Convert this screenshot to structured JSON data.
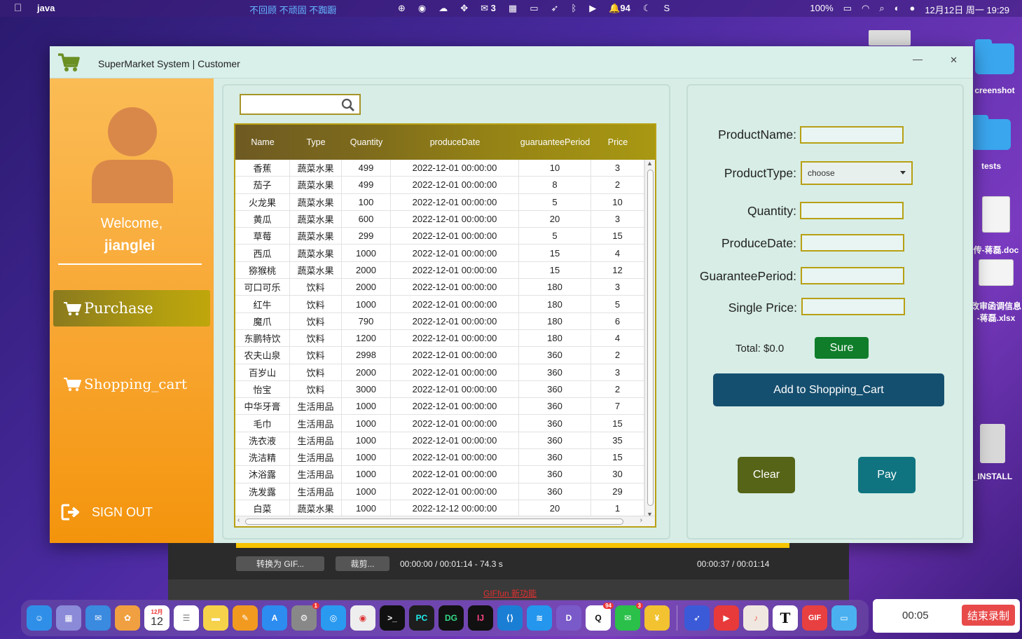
{
  "menubar": {
    "app_name": "java",
    "center_text": "不回顾 不顽固 不踟蹰",
    "wechat_count": "3",
    "notif_count": "94",
    "battery": "100%",
    "datetime": "12月12日 周一  19:29"
  },
  "desktop": {
    "screenshot_label": "creenshot",
    "tests_label": "tests",
    "doc_label": "传-蒋磊.doc",
    "xlsx_label_1": "改审函调信息",
    "xlsx_label_2": "-蒋磊.xlsx",
    "install_label": "_INSTALL"
  },
  "window": {
    "title": "SuperMarket System | Customer",
    "minimize": "—",
    "close": "✕"
  },
  "sidebar": {
    "welcome": "Welcome,",
    "username": "jianglei",
    "purchase_label": "Purchase",
    "cart_label": "Shopping_cart",
    "signout_label": "SIGN OUT"
  },
  "search": {
    "value": "",
    "placeholder": ""
  },
  "table": {
    "headers": [
      "Name",
      "Type",
      "Quantity",
      "produceDate",
      "guaruanteePeriod",
      "Price"
    ],
    "rows": [
      [
        "香蕉",
        "蔬菜水果",
        "499",
        "2022-12-01 00:00:00",
        "10",
        "3"
      ],
      [
        "茄子",
        "蔬菜水果",
        "499",
        "2022-12-01 00:00:00",
        "8",
        "2"
      ],
      [
        "火龙果",
        "蔬菜水果",
        "100",
        "2022-12-01 00:00:00",
        "5",
        "10"
      ],
      [
        "黄瓜",
        "蔬菜水果",
        "600",
        "2022-12-01 00:00:00",
        "20",
        "3"
      ],
      [
        "草莓",
        "蔬菜水果",
        "299",
        "2022-12-01 00:00:00",
        "5",
        "15"
      ],
      [
        "西瓜",
        "蔬菜水果",
        "1000",
        "2022-12-01 00:00:00",
        "15",
        "4"
      ],
      [
        "猕猴桃",
        "蔬菜水果",
        "2000",
        "2022-12-01 00:00:00",
        "15",
        "12"
      ],
      [
        "可口可乐",
        "饮料",
        "2000",
        "2022-12-01 00:00:00",
        "180",
        "3"
      ],
      [
        "红牛",
        "饮料",
        "1000",
        "2022-12-01 00:00:00",
        "180",
        "5"
      ],
      [
        "魔爪",
        "饮料",
        "790",
        "2022-12-01 00:00:00",
        "180",
        "6"
      ],
      [
        "东鹏特饮",
        "饮料",
        "1200",
        "2022-12-01 00:00:00",
        "180",
        "4"
      ],
      [
        "农夫山泉",
        "饮料",
        "2998",
        "2022-12-01 00:00:00",
        "360",
        "2"
      ],
      [
        "百岁山",
        "饮料",
        "2000",
        "2022-12-01 00:00:00",
        "360",
        "3"
      ],
      [
        "怡宝",
        "饮料",
        "3000",
        "2022-12-01 00:00:00",
        "360",
        "2"
      ],
      [
        "中华牙膏",
        "生活用品",
        "1000",
        "2022-12-01 00:00:00",
        "360",
        "7"
      ],
      [
        "毛巾",
        "生活用品",
        "1000",
        "2022-12-01 00:00:00",
        "360",
        "15"
      ],
      [
        "洗衣液",
        "生活用品",
        "1000",
        "2022-12-01 00:00:00",
        "360",
        "35"
      ],
      [
        "洗洁精",
        "生活用品",
        "1000",
        "2022-12-01 00:00:00",
        "360",
        "15"
      ],
      [
        "沐浴露",
        "生活用品",
        "1000",
        "2022-12-01 00:00:00",
        "360",
        "30"
      ],
      [
        "洗发露",
        "生活用品",
        "1000",
        "2022-12-01 00:00:00",
        "360",
        "29"
      ],
      [
        "白菜",
        "蔬菜水果",
        "1000",
        "2022-12-12 00:00:00",
        "20",
        "1"
      ]
    ]
  },
  "form": {
    "product_name_label": "ProductName:",
    "product_type_label": "ProductType:",
    "product_type_value": "choose",
    "quantity_label": "Quantity:",
    "produce_date_label": "ProduceDate:",
    "guarantee_label": "GuaranteePeriod:",
    "price_label": "Single Price:",
    "total_label": "Total: $0.0",
    "sure_label": "Sure",
    "add_label": "Add to Shopping_Cart",
    "clear_label": "Clear",
    "pay_label": "Pay"
  },
  "recorder": {
    "convert_label": "转换为 GIF...",
    "crop_label": "裁剪...",
    "time_left": "00:00:00 / 00:01:14 - 74.3 s",
    "time_right": "00:00:37 / 00:01:14",
    "link_label": "GIFfun 新功能"
  },
  "dock": {
    "calendar_month": "12月",
    "calendar_day": "12",
    "gif_label": "GIF",
    "text_label": "T"
  },
  "rec_widget": {
    "time": "00:05",
    "stop_label": "结束录制"
  },
  "colors": {
    "sidebar_orange": "#f8a632",
    "purchase_nav": "#b29e10",
    "table_header": "#7d6a1c",
    "sure_green": "#0f7d2a",
    "add_blue": "#154f6f",
    "clear_olive": "#556417",
    "pay_teal": "#0f7480",
    "panel_bg": "#d7ede6"
  }
}
